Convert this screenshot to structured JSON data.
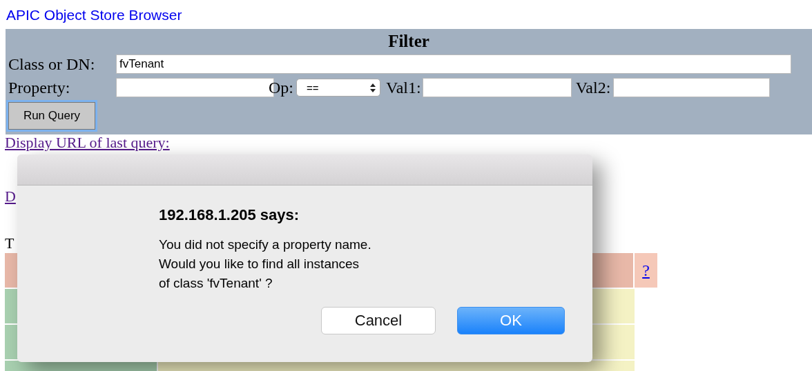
{
  "page_title": "APIC Object Store Browser",
  "filter": {
    "title": "Filter",
    "class_label": "Class or DN:",
    "class_value": "fvTenant",
    "property_label": "Property:",
    "op_label": "Op:",
    "op_value": "==",
    "val1_label": "Val1:",
    "val2_label": "Val2:",
    "run_button": {
      "label": "Run Query",
      "focused": true
    }
  },
  "links": [
    "Display URL of last query:",
    "D"
  ],
  "section_heading": "T",
  "table": {
    "help_link": "?"
  },
  "dialog": {
    "heading": "192.168.1.205 says:",
    "message": [
      "You did not specify a property name.",
      "Would you like to find all instances",
      "of class 'fvTenant' ?"
    ],
    "buttons": [
      {
        "label": "Cancel",
        "kind": "secondary"
      },
      {
        "label": "OK",
        "kind": "default"
      }
    ]
  }
}
